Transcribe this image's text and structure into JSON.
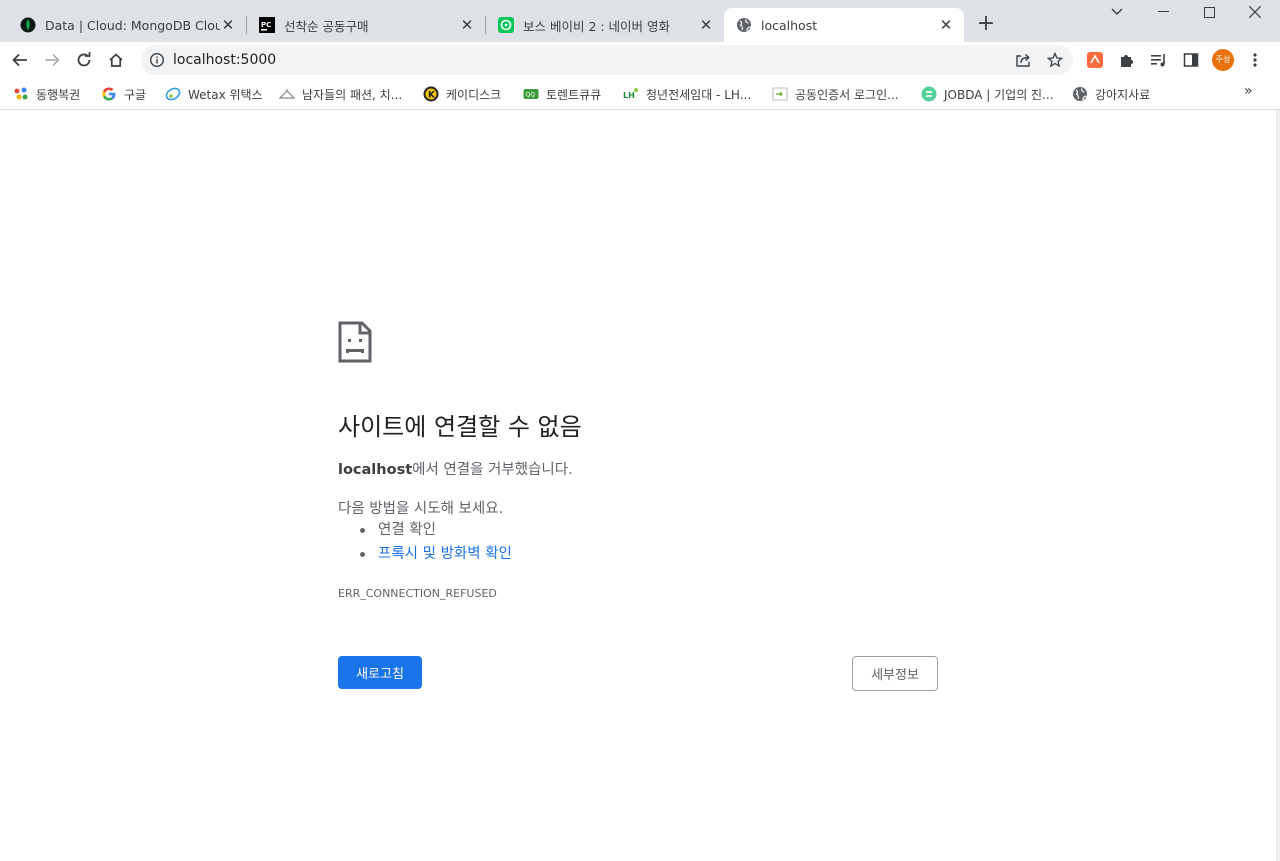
{
  "tabs": [
    {
      "title": "Data | Cloud: MongoDB Cloud",
      "icon": "mongodb-leaf-icon"
    },
    {
      "title": "선착순 공동구매",
      "icon": "pycharm-icon"
    },
    {
      "title": "보스 베이비 2 : 네이버 영화",
      "icon": "naver-movie-icon"
    },
    {
      "title": "localhost",
      "icon": "globe-icon"
    }
  ],
  "toolbar": {
    "url": "localhost:5000",
    "profile_initials": "주성"
  },
  "bookmarks": [
    {
      "label": "동행복권",
      "icon": "lottery-icon"
    },
    {
      "label": "구글",
      "icon": "google-icon"
    },
    {
      "label": "Wetax 위택스",
      "icon": "wetax-icon"
    },
    {
      "label": "남자들의 패션, 치...",
      "icon": "fashion-icon"
    },
    {
      "label": "케이디스크",
      "icon": "kdisk-icon"
    },
    {
      "label": "토렌트큐큐",
      "icon": "torrent-icon"
    },
    {
      "label": "청년전세임대 - LH...",
      "icon": "lh-icon"
    },
    {
      "label": "공동인증서 로그인...",
      "icon": "cert-icon"
    },
    {
      "label": "JOBDA | 기업의 진...",
      "icon": "jobda-icon"
    },
    {
      "label": "강아지사료",
      "icon": "globe-icon"
    }
  ],
  "error": {
    "title": "사이트에 연결할 수 없음",
    "host": "localhost",
    "desc_rest": "에서 연결을 거부했습니다.",
    "try_heading": "다음 방법을 시도해 보세요.",
    "suggestions": [
      "연결 확인",
      "프록시 및 방화벽 확인"
    ],
    "code": "ERR_CONNECTION_REFUSED",
    "reload_label": "새로고침",
    "details_label": "세부정보"
  },
  "colors": {
    "accent": "#1a73e8",
    "tabstrip": "#dee1e6",
    "omnibox": "#f1f3f4",
    "avatar": "#e8710a"
  }
}
